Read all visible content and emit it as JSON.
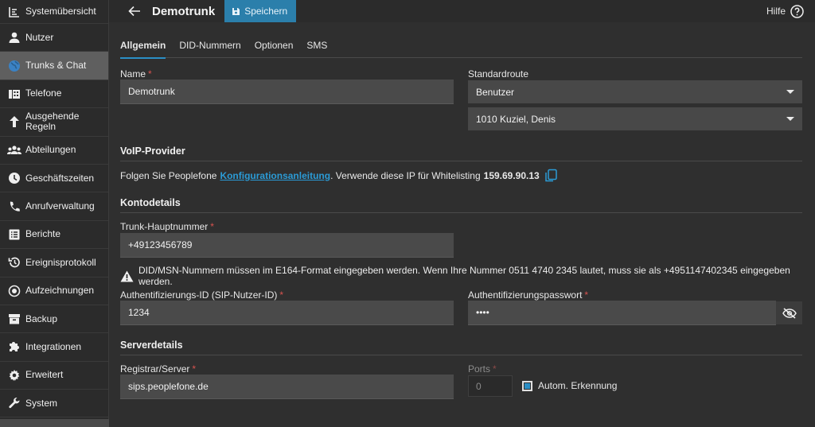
{
  "sidebar": {
    "items": [
      {
        "label": "Systemübersicht",
        "icon": "dashboard-icon"
      },
      {
        "label": "Nutzer",
        "icon": "person-icon"
      },
      {
        "label": "Trunks & Chat",
        "icon": "globe-icon"
      },
      {
        "label": "Telefone",
        "icon": "phone-device-icon"
      },
      {
        "label": "Ausgehende Regeln",
        "icon": "arrow-up-icon"
      },
      {
        "label": "Abteilungen",
        "icon": "group-icon"
      },
      {
        "label": "Geschäftszeiten",
        "icon": "clock-icon"
      },
      {
        "label": "Anrufverwaltung",
        "icon": "phone-icon"
      },
      {
        "label": "Berichte",
        "icon": "report-icon"
      },
      {
        "label": "Ereignisprotokoll",
        "icon": "history-icon"
      },
      {
        "label": "Aufzeichnungen",
        "icon": "record-icon"
      },
      {
        "label": "Backup",
        "icon": "archive-icon"
      },
      {
        "label": "Integrationen",
        "icon": "puzzle-icon"
      },
      {
        "label": "Erweitert",
        "icon": "gear-icon"
      },
      {
        "label": "System",
        "icon": "wrench-icon"
      }
    ],
    "active_index": 2
  },
  "header": {
    "title": "Demotrunk",
    "save_label": "Speichern",
    "help_label": "Hilfe"
  },
  "tabs": [
    "Allgemein",
    "DID-Nummern",
    "Optionen",
    "SMS"
  ],
  "form": {
    "name_label": "Name",
    "name_value": "Demotrunk",
    "route_label": "Standardroute",
    "route_value": "Benutzer",
    "route_user_value": "1010 Kuziel, Denis",
    "voip_section": "VoIP-Provider",
    "voip_text_before": "Folgen Sie Peoplefone",
    "voip_link": "Konfigurationsanleitung",
    "voip_text_after": ". Verwende diese IP für Whitelisting",
    "voip_ip": "159.69.90.13",
    "account_section": "Kontodetails",
    "main_number_label": "Trunk-Hauptnummer",
    "main_number_value": "+49123456789",
    "warning_text": "DID/MSN-Nummern müssen im E164-Format eingegeben werden. Wenn Ihre Nummer 0511 4740 2345 lautet, muss sie als +4951147402345 eingegeben werden.",
    "auth_id_label": "Authentifizierungs-ID (SIP-Nutzer-ID)",
    "auth_id_value": "1234",
    "auth_pw_label": "Authentifizierungspasswort",
    "auth_pw_value": "••••",
    "server_section": "Serverdetails",
    "registrar_label": "Registrar/Server",
    "registrar_value": "sips.peoplefone.de",
    "ports_label": "Ports",
    "ports_value": "0",
    "auto_detect_label": "Autom. Erkennung",
    "required_marker": "*"
  },
  "colors": {
    "accent": "#2b8fc6",
    "save_button": "#2b7fab",
    "required": "#d9534f",
    "link": "#2b9bd6"
  }
}
